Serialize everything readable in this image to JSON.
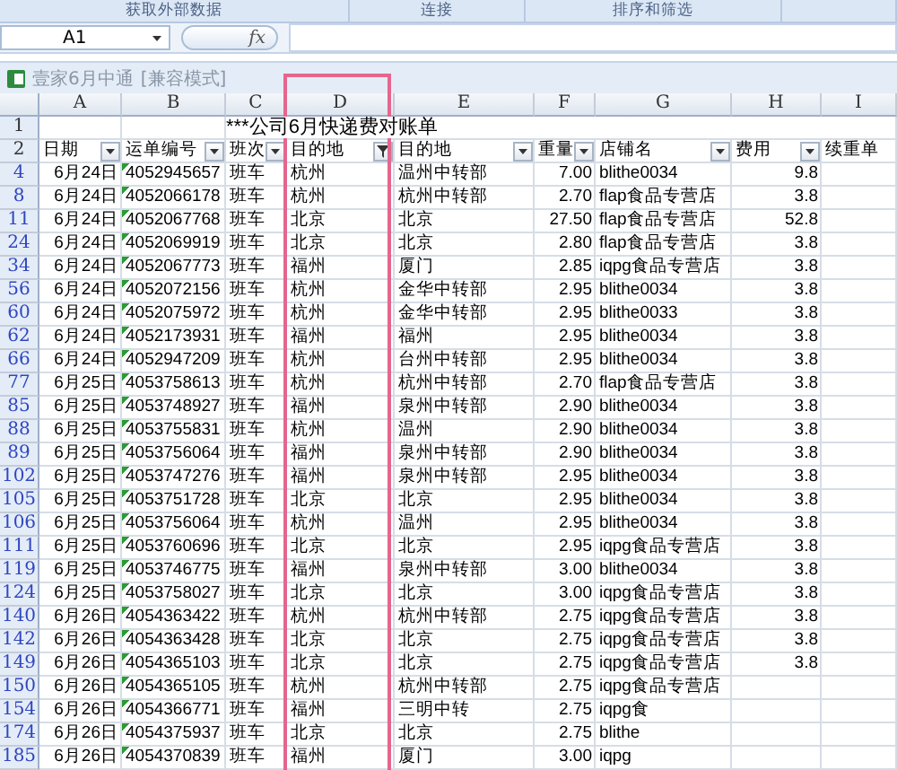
{
  "ribbon_groups": [
    "获取外部数据",
    "连接",
    "排序和筛选"
  ],
  "formula_bar": {
    "name_box": "A1",
    "function_button": "fx"
  },
  "window": {
    "title": "壹家6月中通",
    "mode": "[兼容模式]"
  },
  "columns": [
    {
      "letter": "A",
      "header": "日期",
      "filter_active": false
    },
    {
      "letter": "B",
      "header": "运单编号",
      "filter_active": false
    },
    {
      "letter": "C",
      "header": "班次",
      "filter_active": false
    },
    {
      "letter": "D",
      "header": "目的地",
      "filter_active": true
    },
    {
      "letter": "E",
      "header": "目的地",
      "filter_active": false
    },
    {
      "letter": "F",
      "header": "重量",
      "filter_active": false
    },
    {
      "letter": "G",
      "header": "店铺名",
      "filter_active": false
    },
    {
      "letter": "H",
      "header": "费用",
      "filter_active": false
    },
    {
      "letter": "I",
      "header": "续重单"
    }
  ],
  "title_row": {
    "num": "1",
    "text": "***公司6月快递费对账单"
  },
  "header_row_num": "2",
  "rows": [
    {
      "num": "4",
      "date": "6月24日",
      "waybill": "4052945657",
      "shift": "班车",
      "dest": "杭州",
      "dest2": "温州中转部",
      "weight": "7.00",
      "shop": "blithe0034",
      "fee": "9.8"
    },
    {
      "num": "8",
      "date": "6月24日",
      "waybill": "4052066178",
      "shift": "班车",
      "dest": "杭州",
      "dest2": "杭州中转部",
      "weight": "2.70",
      "shop": "flap食品专营店",
      "fee": "3.8"
    },
    {
      "num": "11",
      "date": "6月24日",
      "waybill": "4052067768",
      "shift": "班车",
      "dest": "北京",
      "dest2": "北京",
      "weight": "27.50",
      "shop": "flap食品专营店",
      "fee": "52.8"
    },
    {
      "num": "24",
      "date": "6月24日",
      "waybill": "4052069919",
      "shift": "班车",
      "dest": "北京",
      "dest2": "北京",
      "weight": "2.80",
      "shop": "flap食品专营店",
      "fee": "3.8"
    },
    {
      "num": "34",
      "date": "6月24日",
      "waybill": "4052067773",
      "shift": "班车",
      "dest": "福州",
      "dest2": "厦门",
      "weight": "2.85",
      "shop": "iqpg食品专营店",
      "fee": "3.8"
    },
    {
      "num": "56",
      "date": "6月24日",
      "waybill": "4052072156",
      "shift": "班车",
      "dest": "杭州",
      "dest2": "金华中转部",
      "weight": "2.95",
      "shop": "blithe0034",
      "fee": "3.8"
    },
    {
      "num": "60",
      "date": "6月24日",
      "waybill": "4052075972",
      "shift": "班车",
      "dest": "杭州",
      "dest2": "金华中转部",
      "weight": "2.95",
      "shop": "blithe0033",
      "fee": "3.8"
    },
    {
      "num": "62",
      "date": "6月24日",
      "waybill": "4052173931",
      "shift": "班车",
      "dest": "福州",
      "dest2": "福州",
      "weight": "2.95",
      "shop": "blithe0034",
      "fee": "3.8"
    },
    {
      "num": "66",
      "date": "6月24日",
      "waybill": "4052947209",
      "shift": "班车",
      "dest": "杭州",
      "dest2": "台州中转部",
      "weight": "2.95",
      "shop": "blithe0034",
      "fee": "3.8"
    },
    {
      "num": "77",
      "date": "6月25日",
      "waybill": "4053758613",
      "shift": "班车",
      "dest": "杭州",
      "dest2": "杭州中转部",
      "weight": "2.70",
      "shop": "flap食品专营店",
      "fee": "3.8"
    },
    {
      "num": "85",
      "date": "6月25日",
      "waybill": "4053748927",
      "shift": "班车",
      "dest": "福州",
      "dest2": "泉州中转部",
      "weight": "2.90",
      "shop": "blithe0034",
      "fee": "3.8"
    },
    {
      "num": "88",
      "date": "6月25日",
      "waybill": "4053755831",
      "shift": "班车",
      "dest": "杭州",
      "dest2": "温州",
      "weight": "2.90",
      "shop": "blithe0034",
      "fee": "3.8"
    },
    {
      "num": "89",
      "date": "6月25日",
      "waybill": "4053756064",
      "shift": "班车",
      "dest": "福州",
      "dest2": "泉州中转部",
      "weight": "2.90",
      "shop": "blithe0034",
      "fee": "3.8"
    },
    {
      "num": "102",
      "date": "6月25日",
      "waybill": "4053747276",
      "shift": "班车",
      "dest": "福州",
      "dest2": "泉州中转部",
      "weight": "2.95",
      "shop": "blithe0034",
      "fee": "3.8"
    },
    {
      "num": "105",
      "date": "6月25日",
      "waybill": "4053751728",
      "shift": "班车",
      "dest": "北京",
      "dest2": "北京",
      "weight": "2.95",
      "shop": "blithe0034",
      "fee": "3.8"
    },
    {
      "num": "106",
      "date": "6月25日",
      "waybill": "4053756064",
      "shift": "班车",
      "dest": "杭州",
      "dest2": "温州",
      "weight": "2.95",
      "shop": "blithe0034",
      "fee": "3.8"
    },
    {
      "num": "111",
      "date": "6月25日",
      "waybill": "4053760696",
      "shift": "班车",
      "dest": "北京",
      "dest2": "北京",
      "weight": "2.95",
      "shop": "iqpg食品专营店",
      "fee": "3.8"
    },
    {
      "num": "119",
      "date": "6月25日",
      "waybill": "4053746775",
      "shift": "班车",
      "dest": "福州",
      "dest2": "泉州中转部",
      "weight": "3.00",
      "shop": "blithe0034",
      "fee": "3.8"
    },
    {
      "num": "124",
      "date": "6月25日",
      "waybill": "4053758027",
      "shift": "班车",
      "dest": "北京",
      "dest2": "北京",
      "weight": "3.00",
      "shop": "iqpg食品专营店",
      "fee": "3.8"
    },
    {
      "num": "140",
      "date": "6月26日",
      "waybill": "4054363422",
      "shift": "班车",
      "dest": "杭州",
      "dest2": "杭州中转部",
      "weight": "2.75",
      "shop": "iqpg食品专营店",
      "fee": "3.8"
    },
    {
      "num": "142",
      "date": "6月26日",
      "waybill": "4054363428",
      "shift": "班车",
      "dest": "北京",
      "dest2": "北京",
      "weight": "2.75",
      "shop": "iqpg食品专营店",
      "fee": "3.8"
    },
    {
      "num": "149",
      "date": "6月26日",
      "waybill": "4054365103",
      "shift": "班车",
      "dest": "北京",
      "dest2": "北京",
      "weight": "2.75",
      "shop": "iqpg食品专营店",
      "fee": "3.8"
    },
    {
      "num": "150",
      "date": "6月26日",
      "waybill": "4054365105",
      "shift": "班车",
      "dest": "杭州",
      "dest2": "杭州中转部",
      "weight": "2.75",
      "shop": "iqpg食品专营店"
    },
    {
      "num": "154",
      "date": "6月26日",
      "waybill": "4054366771",
      "shift": "班车",
      "dest": "福州",
      "dest2": "三明中转",
      "weight": "2.75",
      "shop": "iqpg食"
    },
    {
      "num": "174",
      "date": "6月26日",
      "waybill": "4054375937",
      "shift": "班车",
      "dest": "北京",
      "dest2": "北京",
      "weight": "2.75",
      "shop": "blithe"
    },
    {
      "num": "185",
      "date": "6月26日",
      "waybill": "4054370839",
      "shift": "班车",
      "dest": "福州",
      "dest2": "厦门",
      "weight": "3.00",
      "shop": "iqpg"
    }
  ]
}
